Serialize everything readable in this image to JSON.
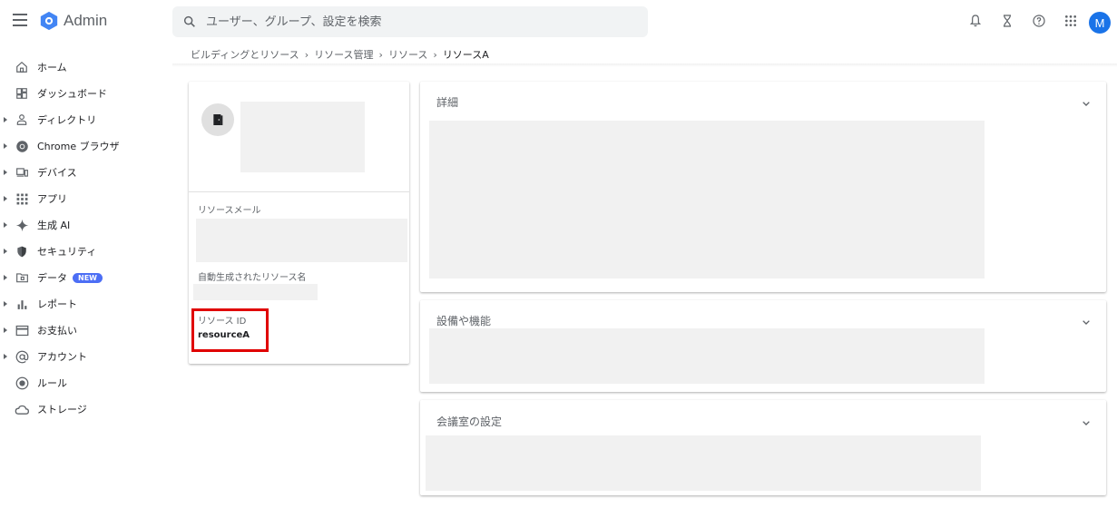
{
  "app": {
    "name": "Admin",
    "accent": "#1a73e8"
  },
  "search": {
    "placeholder": "ユーザー、グループ、設定を検索"
  },
  "user": {
    "avatar_initial": "M"
  },
  "breadcrumb": {
    "items": [
      "ビルディングとリソース",
      "リソース管理",
      "リソース"
    ],
    "separator": "›",
    "current": "リソースA"
  },
  "sidebar": {
    "items": [
      {
        "label": "ホーム",
        "icon": "home-icon",
        "expandable": false
      },
      {
        "label": "ダッシュボード",
        "icon": "dashboard-icon",
        "expandable": false
      },
      {
        "label": "ディレクトリ",
        "icon": "person-icon",
        "expandable": true
      },
      {
        "label": "Chrome ブラウザ",
        "icon": "chrome-icon",
        "expandable": true
      },
      {
        "label": "デバイス",
        "icon": "devices-icon",
        "expandable": true
      },
      {
        "label": "アプリ",
        "icon": "apps-grid-icon",
        "expandable": true
      },
      {
        "label": "生成 AI",
        "icon": "sparkle-icon",
        "expandable": true
      },
      {
        "label": "セキュリティ",
        "icon": "shield-icon",
        "expandable": true
      },
      {
        "label": "データ",
        "icon": "folder-icon",
        "expandable": true,
        "badge": "NEW"
      },
      {
        "label": "レポート",
        "icon": "bar-chart-icon",
        "expandable": true
      },
      {
        "label": "お支払い",
        "icon": "credit-card-icon",
        "expandable": true
      },
      {
        "label": "アカウント",
        "icon": "at-sign-icon",
        "expandable": true
      },
      {
        "label": "ルール",
        "icon": "rules-icon",
        "expandable": false
      },
      {
        "label": "ストレージ",
        "icon": "cloud-icon",
        "expandable": false
      }
    ]
  },
  "resource_card": {
    "icon": "door-icon",
    "email_label": "リソースメール",
    "auto_name_label": "自動生成されたリソース名",
    "id_label": "リソース ID",
    "id_value": "resourceA"
  },
  "sections": {
    "details": "詳細",
    "features": "設備や機能",
    "room_settings": "会議室の設定"
  },
  "colors": {
    "highlight": "#e00000",
    "badge": "#4c6ef5",
    "placeholder": "#f1f1f1"
  }
}
